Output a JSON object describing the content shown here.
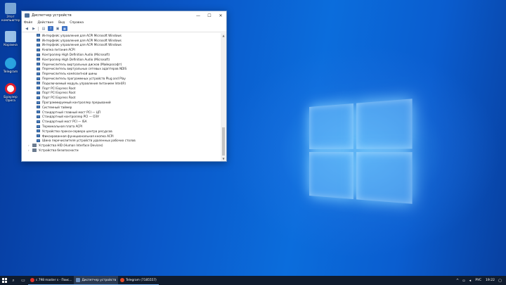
{
  "desktop": {
    "icons": [
      {
        "label": "Этот компьютер",
        "color": "#7aa6d6"
      },
      {
        "label": "Корзина",
        "color": "#9ac1e8"
      },
      {
        "label": "Telegram",
        "color": "#2aa3e0"
      },
      {
        "label": "Браузер Opera",
        "color": "#e21b2a"
      }
    ]
  },
  "window": {
    "title": "Диспетчер устройств",
    "controls": {
      "minimize": "—",
      "maximize": "☐",
      "close": "✕"
    },
    "menu": [
      "Файл",
      "Действие",
      "Вид",
      "Справка"
    ],
    "toolbar": {
      "back": "◀",
      "forward": "▶",
      "properties": "▤",
      "help": "?",
      "update": "▣",
      "view": "▦"
    },
    "devices": [
      "Интерфейс управления для ACPI Microsoft Windows",
      "Интерфейс управления для ACPI Microsoft Windows",
      "Интерфейс управления для ACPI Microsoft Windows",
      "Кнопка питания ACPI",
      "Контроллер High Definition Audio (Microsoft)",
      "Контроллер High Definition Audio (Microsoft)",
      "Перечислитель виртуальных дисков (Майкрософт)",
      "Перечислитель виртуальных сетевых адаптеров NDIS",
      "Перечислитель композитной шины",
      "Перечислитель программных устройств Plug and Play",
      "Подключаемый модуль управления питанием Intel(R)",
      "Порт PCI Express Root",
      "Порт PCI Express Root",
      "Порт PCI Express Root",
      "Программируемый контроллер прерываний",
      "Системный таймер",
      "Стандартный главный мост PCI — ЦП",
      "Стандартный контроллер PCI — ОЗУ",
      "Стандартный мост PCI — ISA",
      "Терминальная плата ACPI",
      "Устройство прокси-сервера центра ресурсов",
      "Фиксированная функциональная кнопка ACPI",
      "Шина перечислителя устройств удаленных рабочих столов"
    ],
    "categories": [
      {
        "expander": "›",
        "label": "Устройства HID (Human Interface Devices)"
      },
      {
        "expander": "›",
        "label": "Устройства безопасности"
      }
    ]
  },
  "taskbar": {
    "search_icon": "⌕",
    "taskview_icon": "▭",
    "apps": [
      {
        "label": "с 798 master s - Поис...",
        "color": "#e0312b",
        "active": false
      },
      {
        "label": "Диспетчер устройств",
        "color": "#6b8fbf",
        "active": true
      },
      {
        "label": "Telegram (7185557)",
        "color": "#e24a2a",
        "active": false
      }
    ],
    "tray": {
      "chevron": "^",
      "network_icon": "▫",
      "volume_icon": "◂",
      "language": "РУС",
      "time": "19:22",
      "notification_icon": "▢"
    }
  },
  "colors": {
    "accent": "#0a6ad8",
    "taskbar": "#101c2e",
    "window_border": "#6b8fbf"
  }
}
